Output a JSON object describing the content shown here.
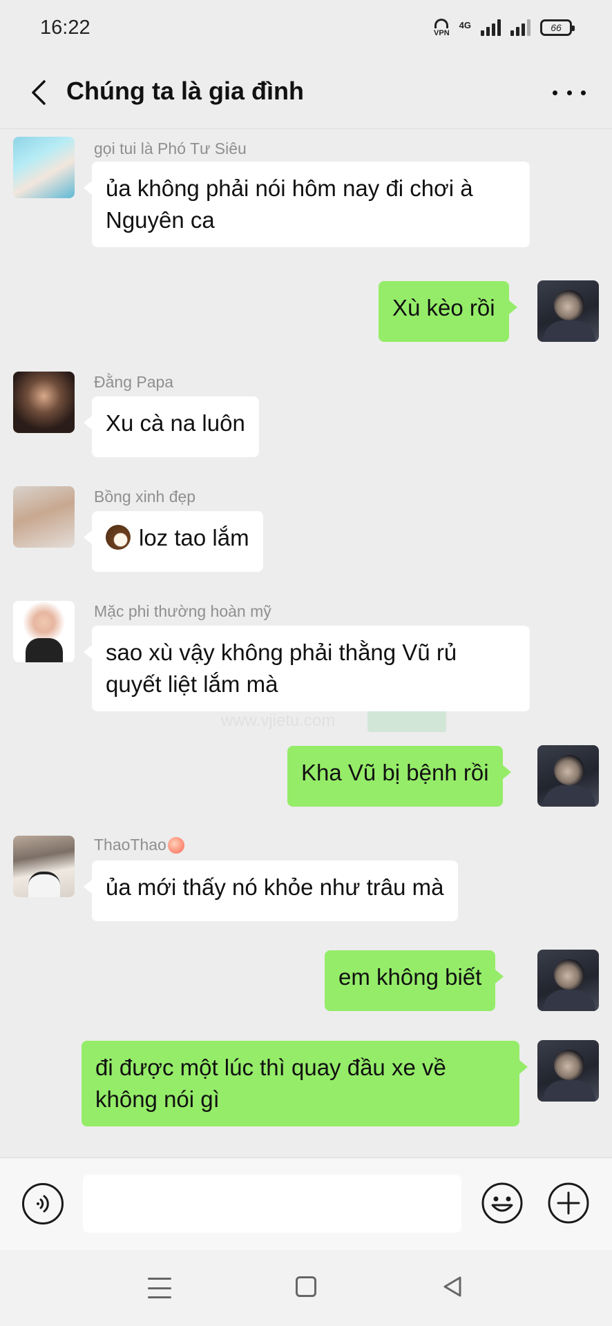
{
  "status_bar": {
    "time": "16:22",
    "vpn_label": "VPN",
    "network_label": "4G",
    "battery_level": "66"
  },
  "header": {
    "title": "Chúng ta là gia đình"
  },
  "messages": [
    {
      "side": "in",
      "sender": "gọi tui là Phó Tư Siêu",
      "lines": [
        "ủa không phải nói hôm nay đi chơi à",
        "Nguyên ca"
      ]
    },
    {
      "side": "out",
      "lines": [
        "Xù kèo rồi"
      ]
    },
    {
      "side": "in",
      "sender": "Đằng Papa",
      "lines": [
        "Xu cà na luôn"
      ]
    },
    {
      "side": "in",
      "sender": "Bồng xinh đẹp",
      "emoji": "coconut",
      "lines": [
        "loz tao lắm"
      ]
    },
    {
      "side": "in",
      "sender": "Mặc phi thường hoàn mỹ",
      "lines": [
        "sao xù vậy không phải thằng Vũ rủ",
        "quyết liệt lắm mà"
      ]
    },
    {
      "side": "out",
      "lines": [
        "Kha Vũ bị bệnh rồi"
      ]
    },
    {
      "side": "in",
      "sender": "ThaoThao",
      "sender_emoji": "peach",
      "lines": [
        "ủa mới thấy nó khỏe như trâu mà"
      ]
    },
    {
      "side": "out",
      "lines": [
        "em không biết"
      ]
    },
    {
      "side": "out",
      "lines": [
        "đi được một lúc thì quay đầu xe về",
        "không nói gì"
      ]
    }
  ],
  "watermark": {
    "text": "微截图",
    "url": "www.vjietu.com"
  },
  "input": {
    "value": ""
  },
  "colors": {
    "background": "#ededed",
    "outgoing_bubble": "#95ec69",
    "incoming_bubble": "#ffffff",
    "sender_name": "#8f8f8f"
  }
}
